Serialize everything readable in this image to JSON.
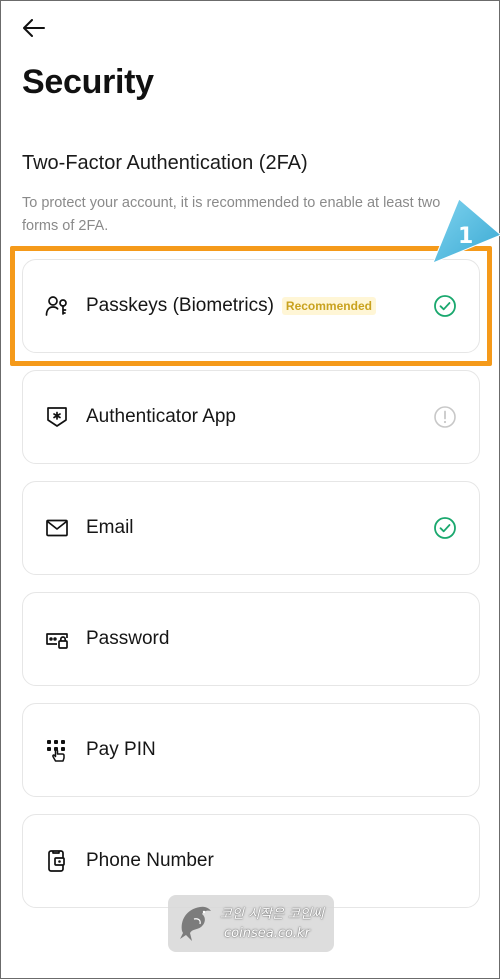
{
  "header": {
    "back_icon": "arrow-left-icon",
    "title": "Security"
  },
  "section": {
    "title": "Two-Factor Authentication (2FA)",
    "description": "To protect your account, it is recommended to enable at least two forms of 2FA."
  },
  "options": [
    {
      "label": "Passkeys (Biometrics)",
      "badge": "Recommended",
      "icon": "passkey-user-icon",
      "status": "enabled"
    },
    {
      "label": "Authenticator App",
      "icon": "authenticator-shield-icon",
      "status": "warning"
    },
    {
      "label": "Email",
      "icon": "envelope-icon",
      "status": "enabled"
    },
    {
      "label": "Password",
      "icon": "password-lock-icon",
      "status": "none"
    },
    {
      "label": "Pay PIN",
      "icon": "keypad-icon",
      "status": "none"
    },
    {
      "label": "Phone Number",
      "icon": "phone-icon",
      "status": "none"
    }
  ],
  "annotation": {
    "step_number": "1"
  },
  "watermark": {
    "line1": "코인 시작은 코인씨",
    "line2": "coinsea.co.kr"
  },
  "colors": {
    "check_green": "#1aa86e",
    "warning_gray": "#c8c8c8",
    "highlight_orange": "#f59a1a",
    "step_blue": "#5bc3e6",
    "badge_text": "#c9a21f",
    "badge_bg": "#fff6d6"
  }
}
